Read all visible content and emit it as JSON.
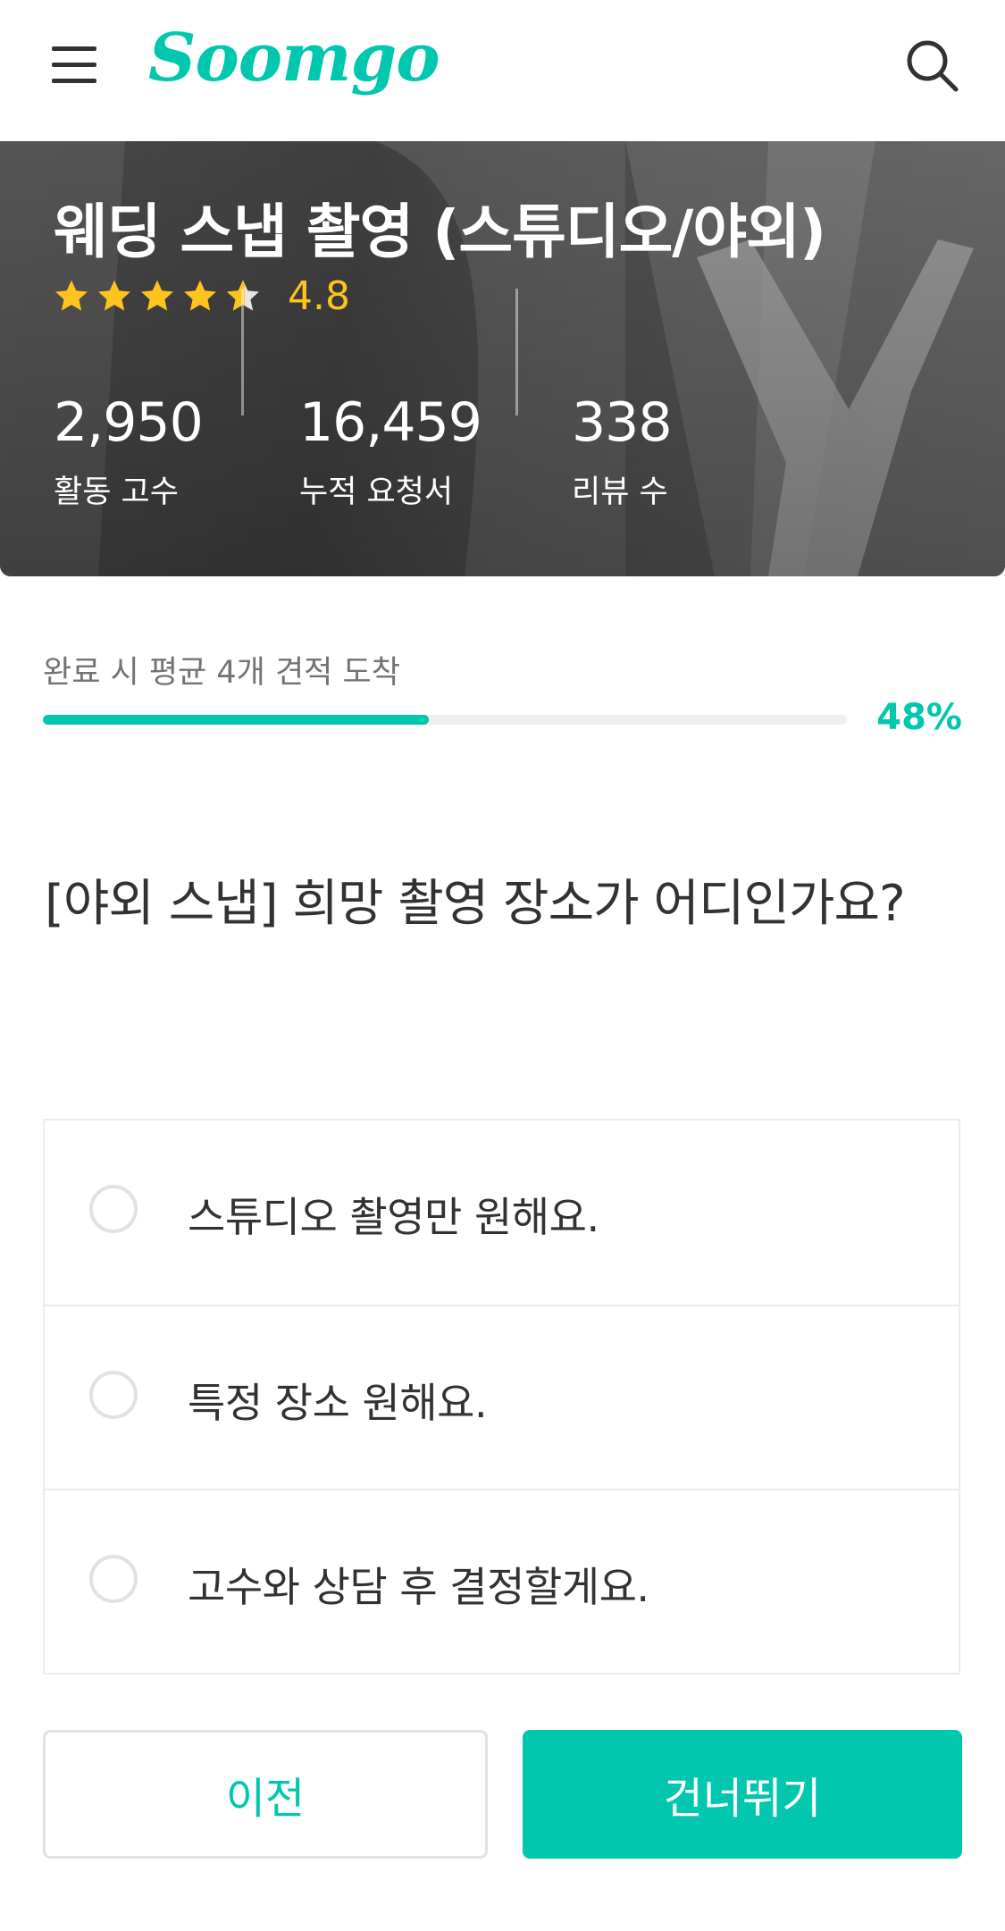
{
  "header": {
    "logo_text": "Soomgo",
    "menu_icon": "hamburger-menu-icon",
    "search_icon": "search-icon"
  },
  "hero": {
    "title": "웨딩 스냅 촬영 (스튜디오/야외)",
    "rating": {
      "value": "4.8",
      "stars": 4.8,
      "max_stars": 5
    },
    "stats": [
      {
        "value": "2,950",
        "label": "활동 고수"
      },
      {
        "value": "16,459",
        "label": "누적 요청서"
      },
      {
        "value": "338",
        "label": "리뷰 수"
      }
    ]
  },
  "progress": {
    "caption": "완료 시 평균 4개 견적 도착",
    "percent_label": "48%",
    "fraction": 0.48
  },
  "question": "[야외 스냅] 희망 촬영 장소가 어디인가요?",
  "options": [
    {
      "label": "스튜디오 촬영만 원해요.",
      "selected": false
    },
    {
      "label": "특정 장소 원해요.",
      "selected": false
    },
    {
      "label": "고수와 상담 후 결정할게요.",
      "selected": false
    }
  ],
  "buttons": {
    "prev": "이전",
    "skip": "건너뛰기"
  },
  "colors": {
    "brand": "#00c7ae",
    "star": "#ffc31e",
    "text": "#323232",
    "muted": "#737373"
  }
}
